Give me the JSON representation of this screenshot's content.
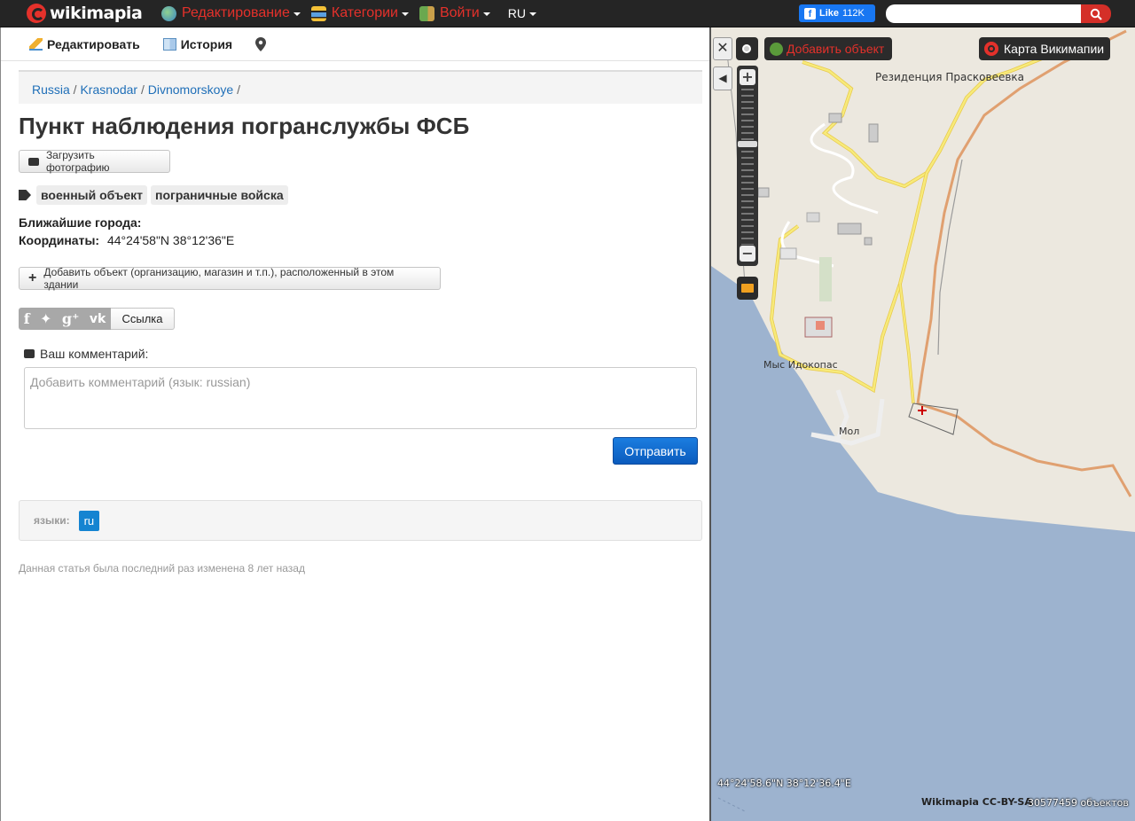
{
  "topbar": {
    "logo_text": "wikimapia",
    "menu": [
      {
        "label": "Редактирование",
        "icon": "edit-globe-icon"
      },
      {
        "label": "Категории",
        "icon": "categories-icon"
      },
      {
        "label": "Войти",
        "icon": "login-icon"
      }
    ],
    "language": "RU",
    "like_label": "Like",
    "like_count": "112K",
    "search_placeholder": ""
  },
  "panel": {
    "toolbar": {
      "edit_label": "Редактировать",
      "history_label": "История"
    },
    "breadcrumbs": [
      "Russia",
      "Krasnodar",
      "Divnomorskoye"
    ],
    "title": "Пункт наблюдения погранслужбы ФСБ",
    "upload_photo_label": "Загрузить фотографию",
    "tags": [
      "военный объект",
      "пограничные войска"
    ],
    "nearest_cities_label": "Ближайшие города:",
    "coordinates_label": "Координаты:",
    "coordinates_value": "44°24'58\"N 38°12'36\"E",
    "add_object_label": "Добавить объект (организацию, магазин и т.п.), расположенный в этом здании",
    "share_link_label": "Ссылка",
    "comment_label": "Ваш комментарий:",
    "comment_placeholder": "Добавить комментарий (язык: russian)",
    "send_label": "Отправить",
    "languages_label": "языки:",
    "languages": [
      "ru"
    ],
    "last_edited": "Данная статья была последний раз изменена 8 лет назад"
  },
  "map": {
    "add_object_label": "Добавить объект",
    "wikimapia_map_label": "Карта Викимапии",
    "labels": {
      "residence": "Резиденция Прасковеевка",
      "cape": "Мыс Идокопас",
      "pier": "Мол"
    },
    "coordinate_readout": "44°24'58.6\"N 38°12'36.4\"E",
    "copyright": "Wikimapia CC-BY-SA",
    "object_count": "30577459 объектов",
    "colors": {
      "sea": "#9db3cf",
      "land": "#ece8df",
      "road_major": "#f5e26b",
      "road_minor": "#ffffff",
      "boundary": "#e0a070"
    }
  }
}
